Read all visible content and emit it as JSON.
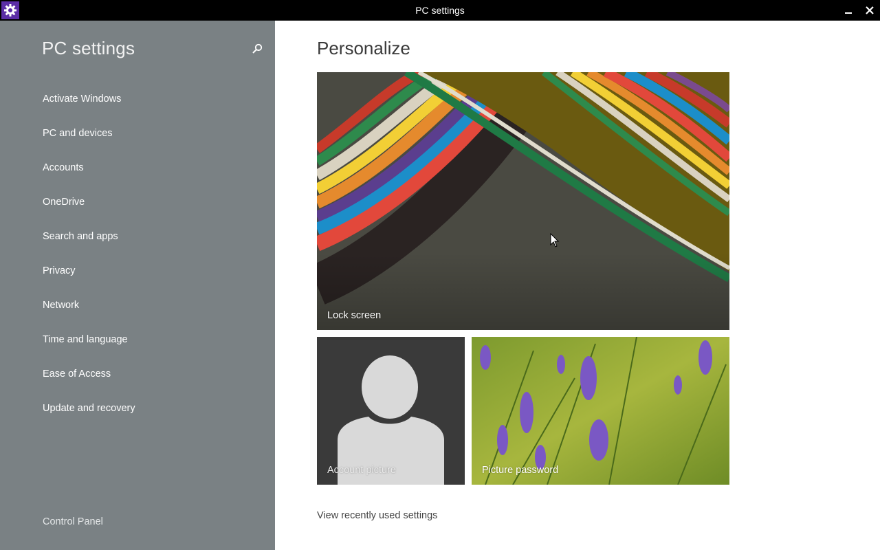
{
  "window": {
    "title": "PC settings",
    "icon": "gear-icon",
    "buttons": [
      "minimize-icon",
      "close-icon"
    ],
    "accent_color": "#5b2ea6"
  },
  "sidebar": {
    "title": "PC settings",
    "search_icon": "search-icon",
    "background": "#7a8184",
    "items": [
      {
        "label": "Activate Windows"
      },
      {
        "label": "PC and devices"
      },
      {
        "label": "Accounts"
      },
      {
        "label": "OneDrive"
      },
      {
        "label": "Search and apps"
      },
      {
        "label": "Privacy"
      },
      {
        "label": "Network"
      },
      {
        "label": "Time and language"
      },
      {
        "label": "Ease of Access"
      },
      {
        "label": "Update and recovery"
      }
    ],
    "footer_link": "Control Panel"
  },
  "main": {
    "title": "Personalize",
    "tiles": {
      "lock_screen": "Lock screen",
      "account_picture": "Account picture",
      "picture_password": "Picture password"
    },
    "recent_link": "View recently used settings"
  }
}
